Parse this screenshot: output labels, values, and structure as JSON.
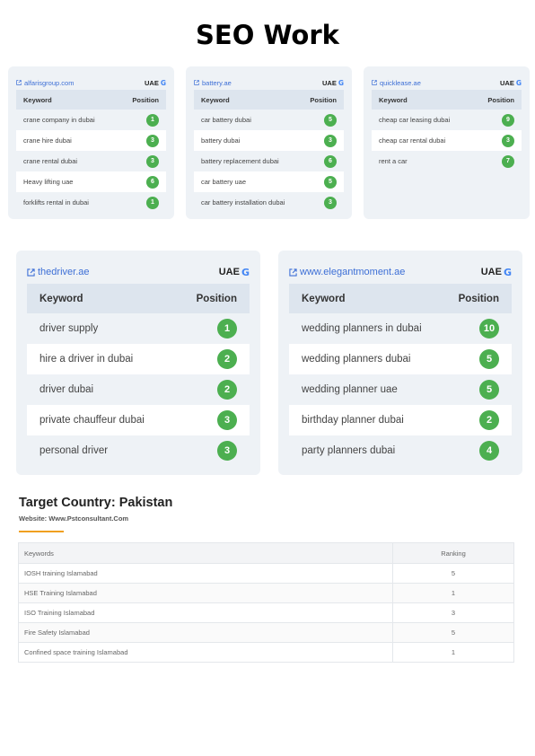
{
  "title": "SEO Work",
  "small_cards": [
    {
      "site": "alfarisgroup.com",
      "region": "UAE",
      "col_keyword": "Keyword",
      "col_position": "Position",
      "rows": [
        {
          "keyword": "crane company in dubai",
          "position": "1"
        },
        {
          "keyword": "crane hire dubai",
          "position": "3"
        },
        {
          "keyword": "crane rental dubai",
          "position": "3"
        },
        {
          "keyword": "Heavy lifting uae",
          "position": "6"
        },
        {
          "keyword": "forklifts rental in dubai",
          "position": "1"
        }
      ]
    },
    {
      "site": "battery.ae",
      "region": "UAE",
      "col_keyword": "Keyword",
      "col_position": "Position",
      "rows": [
        {
          "keyword": "car battery dubai",
          "position": "5"
        },
        {
          "keyword": "battery dubai",
          "position": "3"
        },
        {
          "keyword": "battery replacement dubai",
          "position": "6"
        },
        {
          "keyword": "car battery uae",
          "position": "5"
        },
        {
          "keyword": "car battery installation dubai",
          "position": "3"
        }
      ]
    },
    {
      "site": "quicklease.ae",
      "region": "UAE",
      "col_keyword": "Keyword",
      "col_position": "Position",
      "rows": [
        {
          "keyword": "cheap car leasing dubai",
          "position": "9"
        },
        {
          "keyword": "cheap car rental dubai",
          "position": "3"
        },
        {
          "keyword": "rent a car",
          "position": "7"
        }
      ]
    }
  ],
  "large_cards": [
    {
      "site": "thedriver.ae",
      "region": "UAE",
      "col_keyword": "Keyword",
      "col_position": "Position",
      "rows": [
        {
          "keyword": "driver supply",
          "position": "1"
        },
        {
          "keyword": "hire a driver in dubai",
          "position": "2"
        },
        {
          "keyword": "driver dubai",
          "position": "2"
        },
        {
          "keyword": "private chauffeur dubai",
          "position": "3"
        },
        {
          "keyword": "personal driver",
          "position": "3"
        }
      ]
    },
    {
      "site": "www.elegantmoment.ae",
      "region": "UAE",
      "col_keyword": "Keyword",
      "col_position": "Position",
      "rows": [
        {
          "keyword": "wedding planners in dubai",
          "position": "10"
        },
        {
          "keyword": "wedding planners dubai",
          "position": "5"
        },
        {
          "keyword": "wedding planner uae",
          "position": "5"
        },
        {
          "keyword": "birthday planner dubai",
          "position": "2"
        },
        {
          "keyword": "party planners dubai",
          "position": "4"
        }
      ]
    }
  ],
  "pakistan": {
    "title": "Target Country: Pakistan",
    "website": "Website: Www.Pstconsultant.Com",
    "col_keywords": "Keywords",
    "col_ranking": "Ranking",
    "rows": [
      {
        "keyword": "IOSH training Islamabad",
        "ranking": "5"
      },
      {
        "keyword": "HSE Training Islamabad",
        "ranking": "1"
      },
      {
        "keyword": "ISO Training Islamabad",
        "ranking": "3"
      },
      {
        "keyword": "Fire Safety Islamabad",
        "ranking": "5"
      },
      {
        "keyword": "Confined space training Islamabad",
        "ranking": "1"
      }
    ]
  },
  "colors": {
    "badge": "#4caf50",
    "link": "#3d6fd6",
    "card_bg": "#eef2f6",
    "accent_rule": "#f0a020"
  },
  "icons": {
    "site_link": "external-link-icon",
    "engine": "google-icon"
  }
}
